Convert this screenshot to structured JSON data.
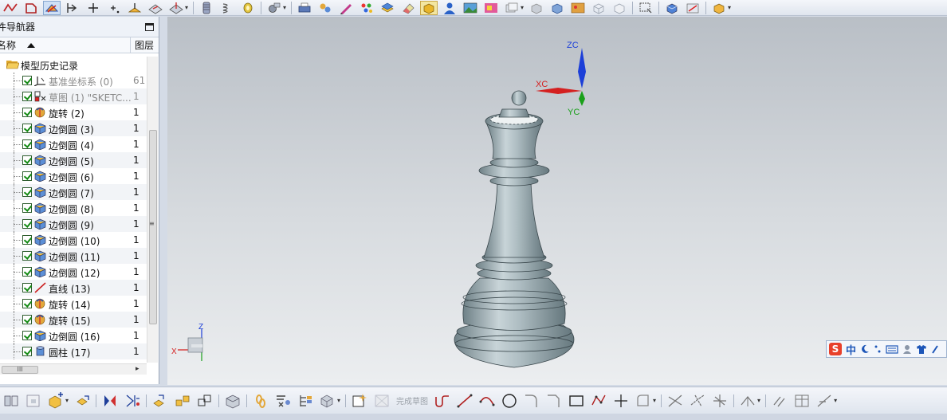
{
  "navigator": {
    "title": "件导航器",
    "columns": {
      "name": "名称",
      "layer": "图层"
    },
    "root_label": "模型历史记录",
    "features": [
      {
        "label": "基准坐标系 (0)",
        "layer": "61",
        "icon": "datum-csys-icon",
        "dim": true
      },
      {
        "label": "草图 (1) \"SKETC...",
        "layer": "1",
        "icon": "sketch-icon",
        "dim": true
      },
      {
        "label": "旋转 (2)",
        "layer": "1",
        "icon": "revolve-icon",
        "dim": false
      },
      {
        "label": "边倒圆 (3)",
        "layer": "1",
        "icon": "edge-blend-icon",
        "dim": false
      },
      {
        "label": "边倒圆 (4)",
        "layer": "1",
        "icon": "edge-blend-icon",
        "dim": false
      },
      {
        "label": "边倒圆 (5)",
        "layer": "1",
        "icon": "edge-blend-icon",
        "dim": false
      },
      {
        "label": "边倒圆 (6)",
        "layer": "1",
        "icon": "edge-blend-icon",
        "dim": false
      },
      {
        "label": "边倒圆 (7)",
        "layer": "1",
        "icon": "edge-blend-icon",
        "dim": false
      },
      {
        "label": "边倒圆 (8)",
        "layer": "1",
        "icon": "edge-blend-icon",
        "dim": false
      },
      {
        "label": "边倒圆 (9)",
        "layer": "1",
        "icon": "edge-blend-icon",
        "dim": false
      },
      {
        "label": "边倒圆 (10)",
        "layer": "1",
        "icon": "edge-blend-icon",
        "dim": false
      },
      {
        "label": "边倒圆 (11)",
        "layer": "1",
        "icon": "edge-blend-icon",
        "dim": false
      },
      {
        "label": "边倒圆 (12)",
        "layer": "1",
        "icon": "edge-blend-icon",
        "dim": false
      },
      {
        "label": "直线 (13)",
        "layer": "1",
        "icon": "line-icon",
        "dim": false
      },
      {
        "label": "旋转 (14)",
        "layer": "1",
        "icon": "revolve-icon",
        "dim": false
      },
      {
        "label": "旋转 (15)",
        "layer": "1",
        "icon": "revolve-icon",
        "dim": false
      },
      {
        "label": "边倒圆 (16)",
        "layer": "1",
        "icon": "edge-blend-icon",
        "dim": false
      },
      {
        "label": "圆柱 (17)",
        "layer": "1",
        "icon": "cylinder-icon",
        "dim": false
      }
    ]
  },
  "viewport": {
    "axis_labels": {
      "zc": "ZC",
      "xc": "XC",
      "yc": "YC"
    },
    "triad_labels": {
      "z": "Z",
      "x": "X"
    },
    "colors": {
      "background_top": "#b9bfc6",
      "background_bottom": "#eceef0",
      "model": "#9fb0b6",
      "x_axis": "#d42020",
      "y_axis": "#1aa01a",
      "z_axis": "#1c3fd8"
    }
  },
  "ime": {
    "brand_glyph": "S",
    "mode": "中"
  },
  "bottom_toolbar": {
    "finish_sketch_label": "完成草图"
  }
}
